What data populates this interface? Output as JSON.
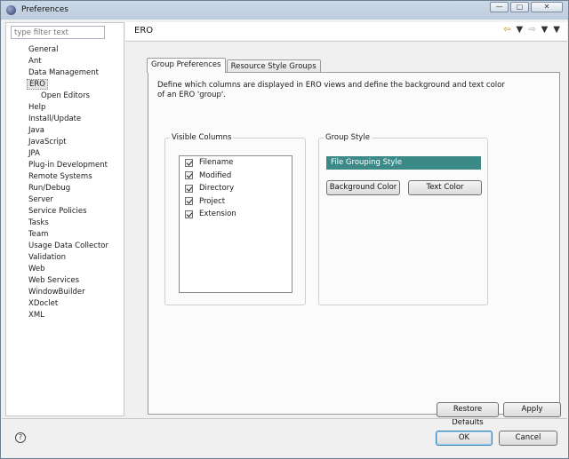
{
  "window": {
    "title": "Preferences",
    "controls": {
      "minimize": "—",
      "maximize": "▢",
      "close": "✕"
    }
  },
  "sidebar": {
    "filter_placeholder": "type filter text",
    "items": [
      {
        "label": "General"
      },
      {
        "label": "Ant"
      },
      {
        "label": "Data Management"
      },
      {
        "label": "ERO",
        "selected": true
      },
      {
        "label": "Open Editors",
        "child": true
      },
      {
        "label": "Help"
      },
      {
        "label": "Install/Update"
      },
      {
        "label": "Java"
      },
      {
        "label": "JavaScript"
      },
      {
        "label": "JPA"
      },
      {
        "label": "Plug-in Development"
      },
      {
        "label": "Remote Systems"
      },
      {
        "label": "Run/Debug"
      },
      {
        "label": "Server"
      },
      {
        "label": "Service Policies"
      },
      {
        "label": "Tasks"
      },
      {
        "label": "Team"
      },
      {
        "label": "Usage Data Collector"
      },
      {
        "label": "Validation"
      },
      {
        "label": "Web"
      },
      {
        "label": "Web Services"
      },
      {
        "label": "WindowBuilder"
      },
      {
        "label": "XDoclet"
      },
      {
        "label": "XML"
      }
    ]
  },
  "page": {
    "title": "ERO",
    "nav_icons": {
      "back": "back-arrow-icon",
      "forward": "forward-arrow-icon",
      "menu": "chevron-down-icon"
    },
    "tabs": [
      {
        "label": "Group Preferences",
        "active": true
      },
      {
        "label": "Resource Style Groups"
      }
    ],
    "description": "Define which columns are displayed in ERO views and define the background and text color of an ERO 'group'.",
    "visible_columns": {
      "legend": "Visible Columns",
      "items": [
        {
          "label": "Filename",
          "checked": true
        },
        {
          "label": "Modified",
          "checked": true
        },
        {
          "label": "Directory",
          "checked": true
        },
        {
          "label": "Project",
          "checked": true
        },
        {
          "label": "Extension",
          "checked": true
        }
      ]
    },
    "group_style": {
      "legend": "Group Style",
      "selected_style": "File Grouping Style",
      "background_button": "Background Color",
      "text_button": "Text Color",
      "style_color": "#3c8a88"
    },
    "restore_defaults": "Restore Defaults",
    "apply": "Apply"
  },
  "footer": {
    "help_icon": "?",
    "ok": "OK",
    "cancel": "Cancel"
  }
}
